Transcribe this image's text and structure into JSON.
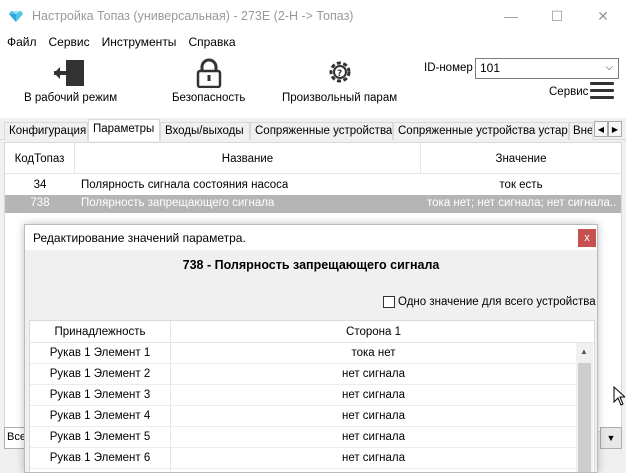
{
  "window": {
    "title": "Настройка Топаз (универсальная) - 273Е (2-Н -> Топаз)",
    "minimize": "—",
    "maximize": "☐",
    "close": "✕"
  },
  "menu": [
    "Файл",
    "Сервис",
    "Инструменты",
    "Справка"
  ],
  "toolbar": {
    "work_mode_label": "В рабочий режим",
    "security_label": "Безопасность",
    "custom_param_label": "Произвольный парам",
    "id_label": "ID-номер",
    "id_value": "101",
    "service_label": "Сервис"
  },
  "tabs": [
    "Конфигурация",
    "Параметры",
    "Входы/выходы",
    "Сопряженные устройства",
    "Сопряженные устройства устар.",
    "Вне"
  ],
  "active_tab": "Параметры",
  "grid": {
    "columns": [
      "КодТопаз",
      "Название",
      "Значение"
    ],
    "rows": [
      {
        "code": "34",
        "name": "Полярность сигнала состояния насоса",
        "value": "ток есть"
      },
      {
        "code": "738",
        "name": "Полярность запрещающего сигнала",
        "value": "тока нет; нет сигнала; нет сигнала..."
      }
    ]
  },
  "bottom": {
    "left_text": "Все"
  },
  "dialog": {
    "title": "Редактирование значений параметра.",
    "close": "x",
    "param_heading": "738 - Полярность запрещающего сигнала",
    "checkbox_label": "Одно значение для всего устройства",
    "columns": [
      "Принадлежность",
      "Сторона  1"
    ],
    "rows": [
      {
        "owner": "Рукав  1 Элемент  1",
        "value": "тока нет"
      },
      {
        "owner": "Рукав  1 Элемент  2",
        "value": "нет сигнала"
      },
      {
        "owner": "Рукав  1 Элемент  3",
        "value": "нет сигнала"
      },
      {
        "owner": "Рукав  1 Элемент  4",
        "value": "нет сигнала"
      },
      {
        "owner": "Рукав  1 Элемент  5",
        "value": "нет сигнала"
      },
      {
        "owner": "Рукав  1 Элемент  6",
        "value": "нет сигнала"
      }
    ]
  },
  "colors": {
    "selected_row": "#b5b5b5",
    "dialog_close": "#c75050",
    "app_icon": "#4fc3e8"
  }
}
